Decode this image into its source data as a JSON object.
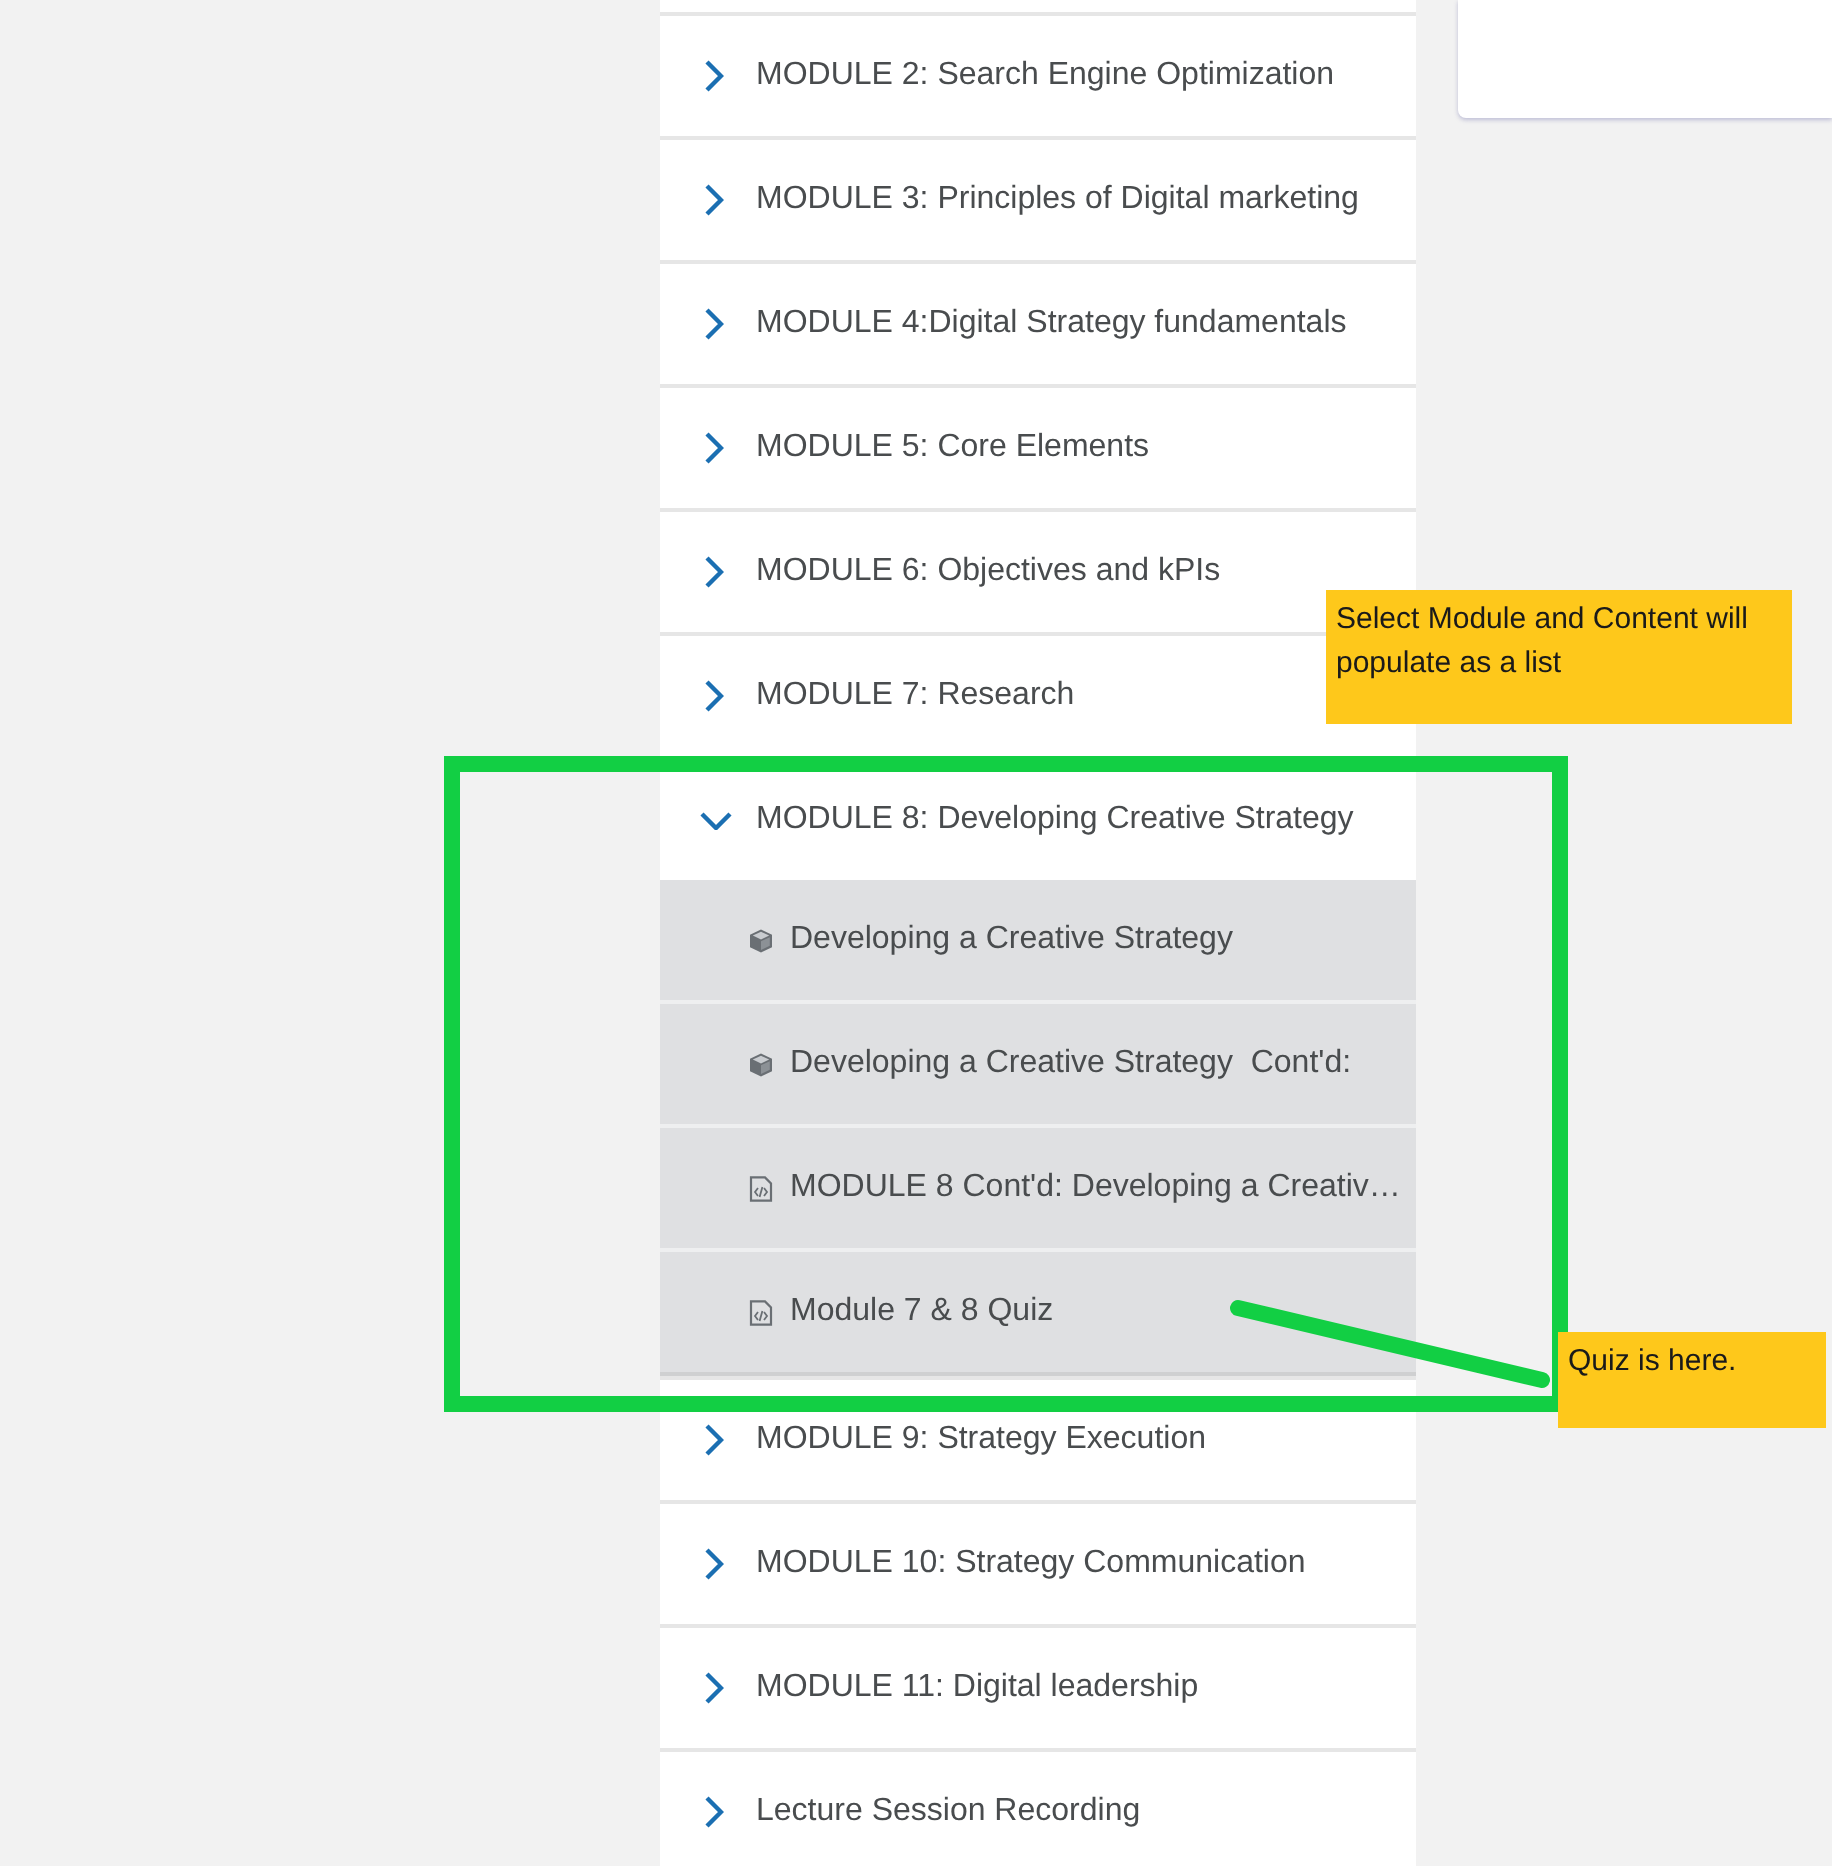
{
  "modules": [
    {
      "title": "MODULE 2: Search Engine Optimization",
      "expanded": false
    },
    {
      "title": "MODULE 3: Principles of Digital marketing",
      "expanded": false
    },
    {
      "title": "MODULE 4:Digital Strategy fundamentals",
      "expanded": false
    },
    {
      "title": "MODULE 5: Core Elements",
      "expanded": false
    },
    {
      "title": "MODULE 6: Objectives and kPIs",
      "expanded": false
    },
    {
      "title": "MODULE 7: Research",
      "expanded": false
    },
    {
      "title": "MODULE 8: Developing Creative Strategy",
      "expanded": true,
      "children": [
        {
          "kind": "package",
          "title": "Developing a Creative Strategy"
        },
        {
          "kind": "package",
          "title": "Developing a Creative Strategy  Cont'd:"
        },
        {
          "kind": "document",
          "title": "MODULE 8 Cont'd: Developing a Creativ…"
        },
        {
          "kind": "document",
          "title": "Module 7 & 8 Quiz"
        }
      ]
    },
    {
      "title": "MODULE 9: Strategy Execution",
      "expanded": false
    },
    {
      "title": "MODULE 10: Strategy Communication",
      "expanded": false
    },
    {
      "title": "MODULE 11: Digital leadership",
      "expanded": false
    },
    {
      "title": "Lecture Session Recording",
      "expanded": false
    }
  ],
  "annotations": [
    {
      "text": "Select Module and Content will populate as a list"
    },
    {
      "text": "Quiz is here."
    }
  ]
}
